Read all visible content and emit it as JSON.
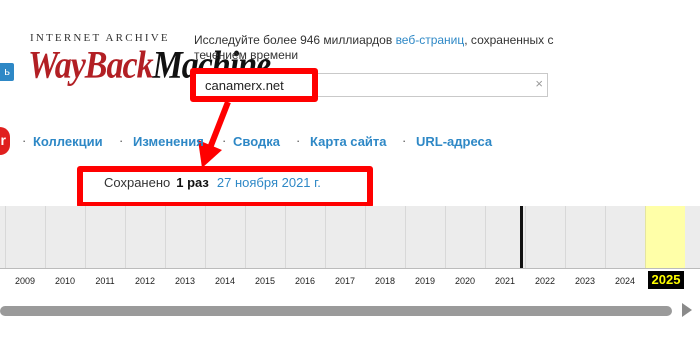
{
  "header": {
    "login_label": "ь",
    "logo_top": "INTERNET ARCHIVE",
    "logo_wayback": "WayBack",
    "logo_machine": "Machine",
    "tagline_before": "Исследуйте более 946 миллиардов ",
    "tagline_link": "веб-страниц",
    "tagline_after": ", сохраненных с течением времени"
  },
  "search": {
    "value": "canamerx.net",
    "clear_icon": "×"
  },
  "nav": {
    "items": [
      "Коллекции",
      "Изменения",
      "Сводка",
      "Карта сайта",
      "URL-адреса"
    ],
    "bullet": "·"
  },
  "saved": {
    "prefix": "Сохранено",
    "count": "1 раз",
    "date": "27 ноября 2021 г."
  },
  "timeline": {
    "years": [
      "2009",
      "2010",
      "2011",
      "2012",
      "2013",
      "2014",
      "2015",
      "2016",
      "2017",
      "2018",
      "2019",
      "2020",
      "2021",
      "2022",
      "2023",
      "2024"
    ],
    "current_year": "2025",
    "snapshot_year": "2021"
  },
  "colors": {
    "accent": "#2e88c6",
    "highlight": "#ff0000",
    "logo_red": "#b21f24"
  }
}
